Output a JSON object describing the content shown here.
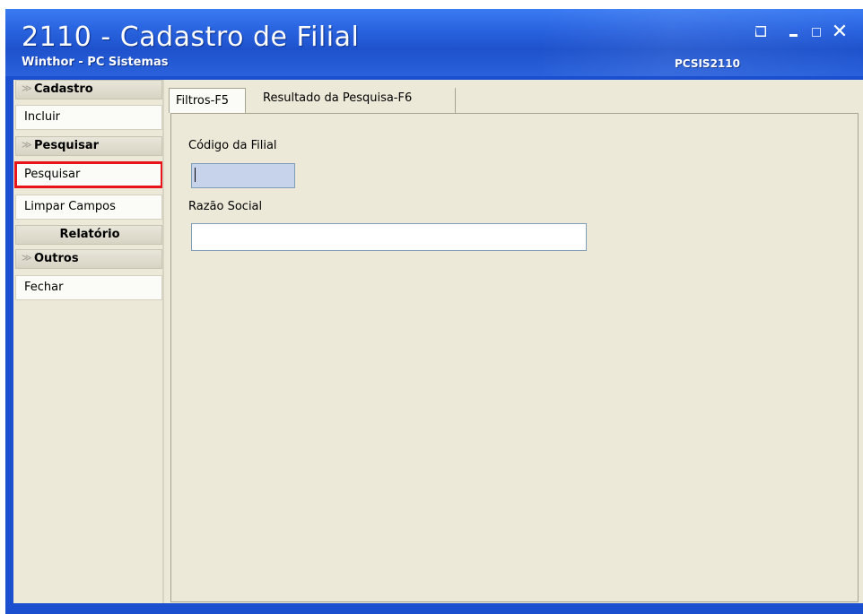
{
  "window": {
    "title": "2110 - Cadastro de Filial",
    "subtitle": "Winthor - PC Sistemas",
    "routine_code": "PCSIS2110"
  },
  "sidebar": {
    "sections": [
      {
        "label": "Cadastro",
        "items": [
          "Incluir"
        ]
      },
      {
        "label": "Pesquisar",
        "items": [
          "Pesquisar",
          "Limpar Campos"
        ]
      },
      {
        "label": "Relatório",
        "items": []
      },
      {
        "label": "Outros",
        "items": [
          "Fechar"
        ]
      }
    ],
    "highlighted_item": "Pesquisar",
    "highlight_color": "#e8141a"
  },
  "tabs": [
    {
      "label": "Filtros-F5",
      "active": true
    },
    {
      "label": "Resultado da Pesquisa-F6",
      "active": false
    }
  ],
  "form": {
    "codigo_label": "Código da Filial",
    "codigo_value": "",
    "razao_label": "Razão Social",
    "razao_value": ""
  },
  "colors": {
    "title_bar": "#2a64e0",
    "client_bg": "#ece9d8",
    "focused_input_bg": "#c6d3ea"
  },
  "icons": [
    "restore-icon",
    "minimize-icon",
    "maximize-icon",
    "close-icon",
    "chevron-down-icon"
  ]
}
